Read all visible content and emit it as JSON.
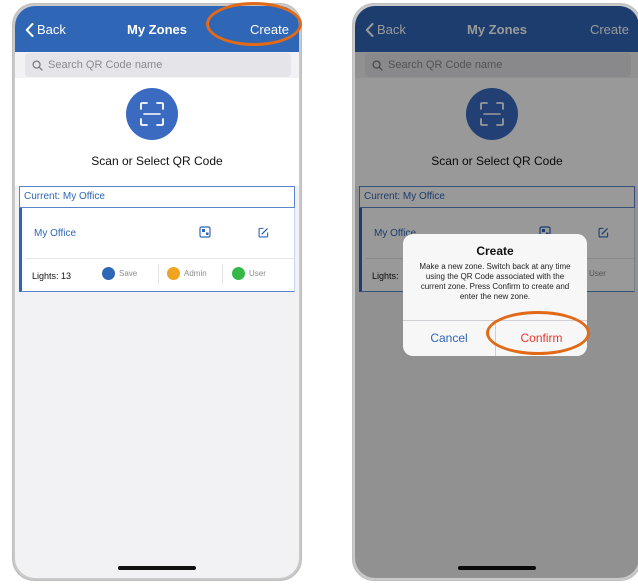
{
  "left_screen": {
    "nav": {
      "back_label": "Back",
      "title": "My Zones",
      "create_label": "Create"
    },
    "search": {
      "placeholder": "Search QR Code name"
    },
    "qr": {
      "label": "Scan or Select QR Code"
    },
    "current": {
      "label": "Current: My Office"
    },
    "zone": {
      "name": "My Office",
      "lights_label": "Lights: 13",
      "roles": [
        {
          "label": "Save",
          "color": "#2f66b6"
        },
        {
          "label": "Admin",
          "color": "#f0a422"
        },
        {
          "label": "User",
          "color": "#34b84a"
        }
      ]
    }
  },
  "right_screen": {
    "nav": {
      "back_label": "Back",
      "title": "My Zones",
      "create_label": "Create"
    },
    "search": {
      "placeholder": "Search QR Code name"
    },
    "qr": {
      "label": "Scan or Select QR Code"
    },
    "current": {
      "label": "Current: My Office"
    },
    "zone": {
      "name": "My Office",
      "lights_label": "Lights:",
      "roles": [
        {
          "label": "User",
          "color": "#34b84a"
        }
      ]
    },
    "alert": {
      "title": "Create",
      "message": "Make a new zone. Switch back at any time using the QR Code associated with the current zone. Press Confirm to create and enter the new zone.",
      "cancel_label": "Cancel",
      "confirm_label": "Confirm"
    }
  },
  "colors": {
    "nav_blue": "#2f66b6",
    "highlight_orange": "#e06a18",
    "confirm_red": "#e8382f"
  }
}
